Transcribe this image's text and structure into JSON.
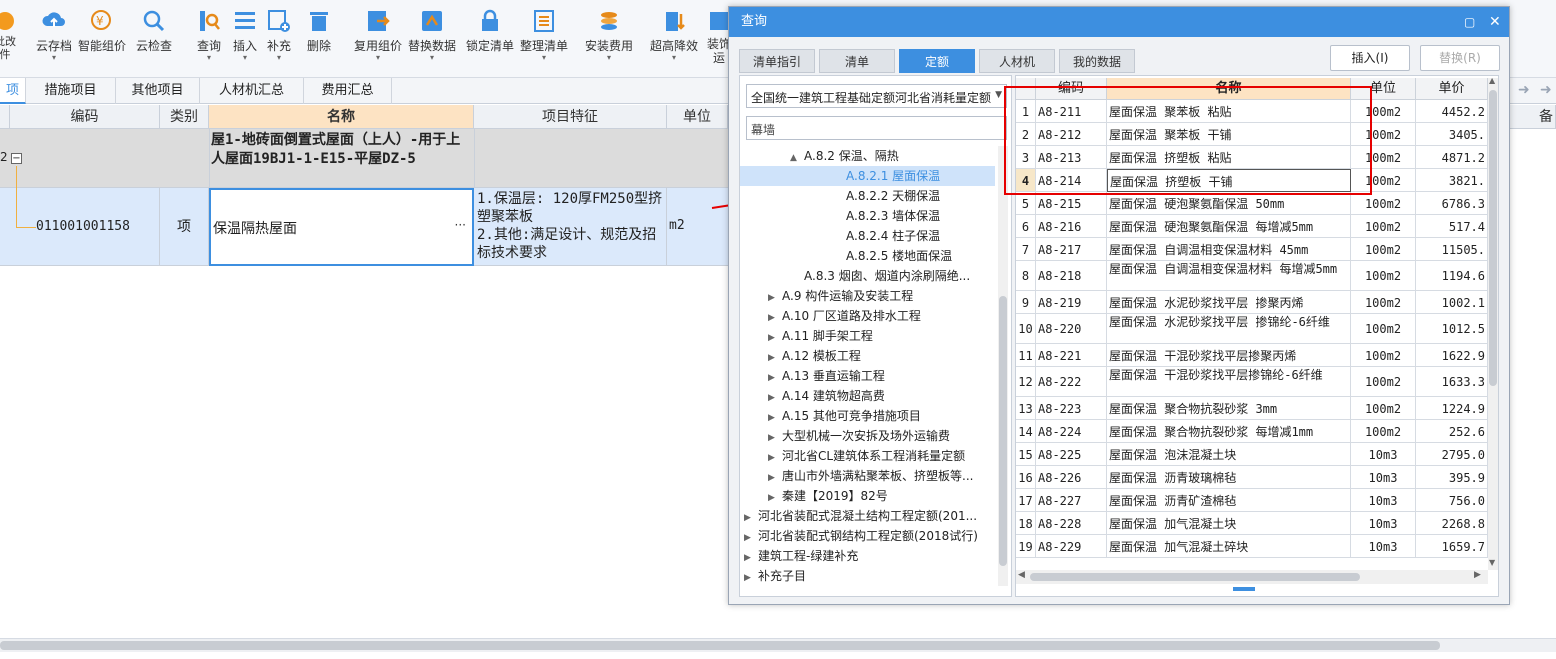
{
  "toolbar": {
    "items": [
      {
        "label": "批改\n件",
        "icon": "batch-icon"
      },
      {
        "label": "云存档",
        "icon": "cloud-save-icon"
      },
      {
        "label": "智能组价",
        "icon": "smart-price-icon"
      },
      {
        "label": "云检查",
        "icon": "cloud-check-icon"
      },
      {
        "label": "查询",
        "icon": "query-icon"
      },
      {
        "label": "插入",
        "icon": "insert-icon"
      },
      {
        "label": "补充",
        "icon": "supplement-icon"
      },
      {
        "label": "删除",
        "icon": "delete-icon"
      },
      {
        "label": "复用组价",
        "icon": "reuse-price-icon"
      },
      {
        "label": "替换数据",
        "icon": "replace-data-icon"
      },
      {
        "label": "锁定清单",
        "icon": "lock-list-icon"
      },
      {
        "label": "整理清单",
        "icon": "organize-list-icon"
      },
      {
        "label": "安装费用",
        "icon": "install-fee-icon"
      },
      {
        "label": "超高降效",
        "icon": "high-reduce-icon"
      },
      {
        "label": "装饰\n运",
        "icon": "decor-icon"
      }
    ]
  },
  "main_tabs": [
    "项",
    "措施项目",
    "其他项目",
    "人材机汇总",
    "费用汇总"
  ],
  "grid": {
    "headers": [
      "编码",
      "类别",
      "名称",
      "项目特征",
      "单位"
    ],
    "right_header": "备",
    "group_row": {
      "index": "2",
      "name": "屋1-地砖面倒置式屋面（上人）-用于上人屋面19BJ1-1-E15-平屋DZ-5"
    },
    "item_row": {
      "code": "011001001158",
      "type": "项",
      "name": "保温隔热屋面",
      "ellipsis": "···",
      "feature": "1.保温层: 120厚FM250型挤塑聚苯板\n2.其他:满足设计、规范及招标技术要求",
      "unit": "m2"
    }
  },
  "dialog": {
    "title": "查询",
    "tabs": [
      "清单指引",
      "清单",
      "定额",
      "人材机",
      "我的数据"
    ],
    "active_tab": "定额",
    "insert_button": "插入(I)",
    "replace_button": "替换(R)",
    "quota_select": "全国统一建筑工程基础定额河北省消耗量定额",
    "search_value": "幕墙",
    "tree": [
      {
        "level": 3,
        "arrow": "▲",
        "label": "A.8.2 保温、隔热"
      },
      {
        "level": 4,
        "arrow": "",
        "label": "A.8.2.1 屋面保温",
        "selected": true
      },
      {
        "level": 4,
        "arrow": "",
        "label": "A.8.2.2 天棚保温"
      },
      {
        "level": 4,
        "arrow": "",
        "label": "A.8.2.3 墙体保温"
      },
      {
        "level": 4,
        "arrow": "",
        "label": "A.8.2.4 柱子保温"
      },
      {
        "level": 4,
        "arrow": "",
        "label": "A.8.2.5 楼地面保温"
      },
      {
        "level": 3,
        "arrow": "",
        "label": "A.8.3 烟囱、烟道内涂刷隔绝..."
      },
      {
        "level": 2,
        "arrow": "▶",
        "label": "A.9 构件运输及安装工程"
      },
      {
        "level": 2,
        "arrow": "▶",
        "label": "A.10 厂区道路及排水工程"
      },
      {
        "level": 2,
        "arrow": "▶",
        "label": "A.11 脚手架工程"
      },
      {
        "level": 2,
        "arrow": "▶",
        "label": "A.12 模板工程"
      },
      {
        "level": 2,
        "arrow": "▶",
        "label": "A.13 垂直运输工程"
      },
      {
        "level": 2,
        "arrow": "▶",
        "label": "A.14 建筑物超高费"
      },
      {
        "level": 2,
        "arrow": "▶",
        "label": "A.15 其他可竞争措施项目"
      },
      {
        "level": 2,
        "arrow": "▶",
        "label": "大型机械一次安拆及场外运输费"
      },
      {
        "level": 2,
        "arrow": "▶",
        "label": "河北省CL建筑体系工程消耗量定额"
      },
      {
        "level": 2,
        "arrow": "▶",
        "label": "唐山市外墙满粘聚苯板、挤塑板等..."
      },
      {
        "level": 2,
        "arrow": "▶",
        "label": "秦建【2019】82号"
      },
      {
        "level": 1,
        "arrow": "▶",
        "label": "河北省装配式混凝土结构工程定额(201..."
      },
      {
        "level": 1,
        "arrow": "▶",
        "label": "河北省装配式钢结构工程定额(2018试行)"
      },
      {
        "level": 1,
        "arrow": "▶",
        "label": "建筑工程-绿建补充"
      },
      {
        "level": 1,
        "arrow": "▶",
        "label": "补充子目"
      }
    ],
    "table_headers": [
      "编码",
      "名称",
      "单位",
      "单价"
    ],
    "rows": [
      {
        "n": "1",
        "code": "A8-211",
        "name": "屋面保温 聚苯板 粘贴",
        "unit": "100m2",
        "price": "4452.2"
      },
      {
        "n": "2",
        "code": "A8-212",
        "name": "屋面保温 聚苯板 干铺",
        "unit": "100m2",
        "price": "3405."
      },
      {
        "n": "3",
        "code": "A8-213",
        "name": "屋面保温 挤塑板 粘贴",
        "unit": "100m2",
        "price": "4871.2"
      },
      {
        "n": "4",
        "code": "A8-214",
        "name": "屋面保温 挤塑板 干铺",
        "unit": "100m2",
        "price": "3821."
      },
      {
        "n": "5",
        "code": "A8-215",
        "name": "屋面保温 硬泡聚氨酯保温 50mm",
        "unit": "100m2",
        "price": "6786.3"
      },
      {
        "n": "6",
        "code": "A8-216",
        "name": "屋面保温 硬泡聚氨酯保温 每增减5mm",
        "unit": "100m2",
        "price": "517.4"
      },
      {
        "n": "7",
        "code": "A8-217",
        "name": "屋面保温 自调温相变保温材料 45mm",
        "unit": "100m2",
        "price": "11505."
      },
      {
        "n": "8",
        "code": "A8-218",
        "name": "屋面保温 自调温相变保温材料 每增减5mm",
        "unit": "100m2",
        "price": "1194.6"
      },
      {
        "n": "9",
        "code": "A8-219",
        "name": "屋面保温 水泥砂浆找平层 掺聚丙烯",
        "unit": "100m2",
        "price": "1002.1"
      },
      {
        "n": "10",
        "code": "A8-220",
        "name": "屋面保温 水泥砂浆找平层 掺锦纶-6纤维",
        "unit": "100m2",
        "price": "1012.5"
      },
      {
        "n": "11",
        "code": "A8-221",
        "name": "屋面保温 干混砂浆找平层掺聚丙烯",
        "unit": "100m2",
        "price": "1622.9"
      },
      {
        "n": "12",
        "code": "A8-222",
        "name": "屋面保温 干混砂浆找平层掺锦纶-6纤维",
        "unit": "100m2",
        "price": "1633.3"
      },
      {
        "n": "13",
        "code": "A8-223",
        "name": "屋面保温 聚合物抗裂砂浆 3mm",
        "unit": "100m2",
        "price": "1224.9"
      },
      {
        "n": "14",
        "code": "A8-224",
        "name": "屋面保温 聚合物抗裂砂浆 每增减1mm",
        "unit": "100m2",
        "price": "252.6"
      },
      {
        "n": "15",
        "code": "A8-225",
        "name": "屋面保温 泡沫混凝土块",
        "unit": "10m3",
        "price": "2795.0"
      },
      {
        "n": "16",
        "code": "A8-226",
        "name": "屋面保温 沥青玻璃棉毡",
        "unit": "10m3",
        "price": "395.9"
      },
      {
        "n": "17",
        "code": "A8-227",
        "name": "屋面保温 沥青矿渣棉毡",
        "unit": "10m3",
        "price": "756.0"
      },
      {
        "n": "18",
        "code": "A8-228",
        "name": "屋面保温 加气混凝土块",
        "unit": "10m3",
        "price": "2268.8"
      },
      {
        "n": "19",
        "code": "A8-229",
        "name": "屋面保温 加气混凝土碎块",
        "unit": "10m3",
        "price": "1659.7"
      }
    ],
    "selected_row": "4"
  },
  "colors": {
    "accent": "#3d8fe0",
    "highlight": "#e60000",
    "selected_row_bg": "#dbe9fb",
    "header_name_bg": "#fde3c3"
  }
}
